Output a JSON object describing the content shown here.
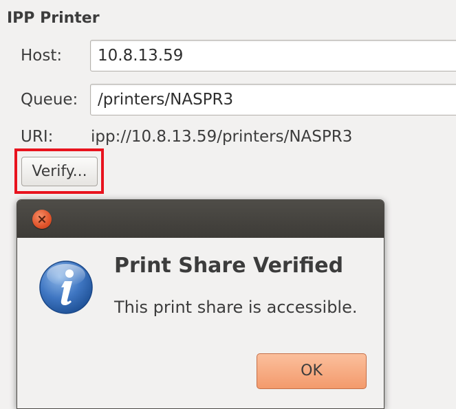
{
  "section": {
    "title": "IPP Printer"
  },
  "form": {
    "host": {
      "label": "Host:",
      "value": "10.8.13.59"
    },
    "queue": {
      "label": "Queue:",
      "value": "/printers/NASPR3"
    },
    "uri": {
      "label": "URI:",
      "value": "ipp://10.8.13.59/printers/NASPR3"
    },
    "verify_label": "Verify..."
  },
  "highlight": {
    "color": "#e8131e"
  },
  "dialog": {
    "icon": "info-icon",
    "title": "Print Share Verified",
    "message": "This print share is accessible.",
    "ok_label": "OK",
    "close_icon": "close-icon",
    "titlebar_color": "#45433f",
    "ok_color": "#f6a77b"
  }
}
